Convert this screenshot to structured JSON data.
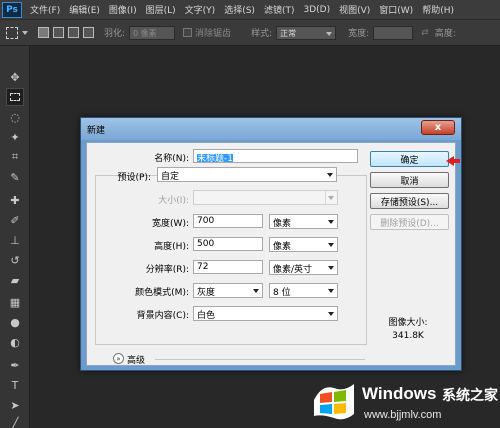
{
  "app": {
    "logo": "Ps"
  },
  "menu": [
    "文件(F)",
    "编辑(E)",
    "图像(I)",
    "图层(L)",
    "文字(Y)",
    "选择(S)",
    "滤镜(T)",
    "3D(D)",
    "视图(V)",
    "窗口(W)",
    "帮助(H)"
  ],
  "options": {
    "feather_label": "羽化:",
    "feather_value": "0 像素",
    "antialias_label": "消除锯齿",
    "style_label": "样式:",
    "style_value": "正常",
    "width_label": "宽度:",
    "height_label": "高度:"
  },
  "tools": [
    "move-icon",
    "marquee-icon",
    "lasso-icon",
    "magic-wand-icon",
    "crop-icon",
    "eyedropper-icon",
    "healing-icon",
    "brush-icon",
    "stamp-icon",
    "history-brush-icon",
    "eraser-icon",
    "gradient-icon",
    "blur-icon",
    "dodge-icon",
    "pen-icon",
    "type-icon",
    "path-select-icon",
    "shape-icon"
  ],
  "dialog": {
    "title": "新建",
    "close": "x",
    "name_label": "名称(N):",
    "name_value": "未标题-1",
    "preset_label": "预设(P):",
    "preset_value": "自定",
    "size_label": "大小(I):",
    "size_value": "",
    "width_label": "宽度(W):",
    "width_value": "700",
    "width_unit": "像素",
    "height_label": "高度(H):",
    "height_value": "500",
    "height_unit": "像素",
    "resolution_label": "分辨率(R):",
    "resolution_value": "72",
    "resolution_unit": "像素/英寸",
    "color_mode_label": "颜色模式(M):",
    "color_mode_value": "灰度",
    "bit_depth_value": "8 位",
    "background_label": "背景内容(C):",
    "background_value": "白色",
    "advanced_label": "高级",
    "buttons": {
      "ok": "确定",
      "cancel": "取消",
      "save_preset": "存储预设(S)...",
      "delete_preset": "删除预设(D)..."
    },
    "image_size_label": "图像大小:",
    "image_size_value": "341.8K"
  },
  "watermark": {
    "brand": "Windows",
    "brand_cn": "系统之家",
    "url": "www.bjjmlv.com"
  },
  "colors": {
    "menubar": "#3c3c3c",
    "workspace": "#282828",
    "dialog_frame": "#6b9bc8",
    "selection": "#3399ff",
    "arrow": "#e02020"
  }
}
